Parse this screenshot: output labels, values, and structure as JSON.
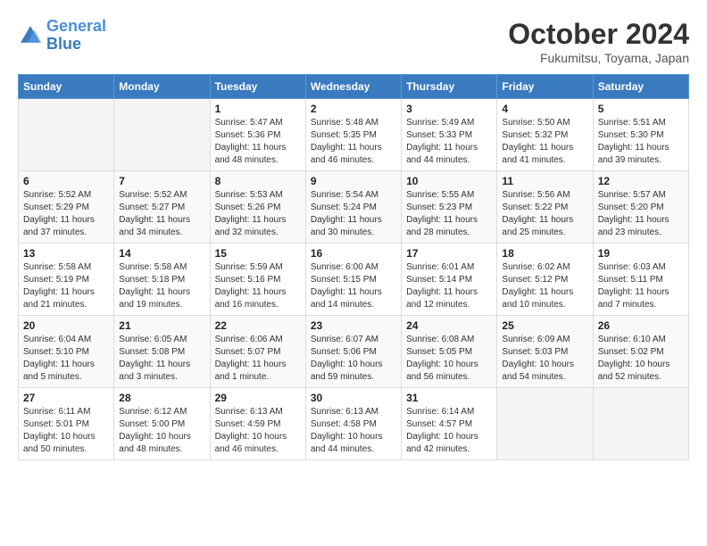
{
  "header": {
    "logo": {
      "line1": "General",
      "line2": "Blue"
    },
    "title": "October 2024",
    "location": "Fukumitsu, Toyama, Japan"
  },
  "columns": [
    "Sunday",
    "Monday",
    "Tuesday",
    "Wednesday",
    "Thursday",
    "Friday",
    "Saturday"
  ],
  "weeks": [
    [
      {
        "day": "",
        "info": ""
      },
      {
        "day": "",
        "info": ""
      },
      {
        "day": "1",
        "info": "Sunrise: 5:47 AM\nSunset: 5:36 PM\nDaylight: 11 hours and 48 minutes."
      },
      {
        "day": "2",
        "info": "Sunrise: 5:48 AM\nSunset: 5:35 PM\nDaylight: 11 hours and 46 minutes."
      },
      {
        "day": "3",
        "info": "Sunrise: 5:49 AM\nSunset: 5:33 PM\nDaylight: 11 hours and 44 minutes."
      },
      {
        "day": "4",
        "info": "Sunrise: 5:50 AM\nSunset: 5:32 PM\nDaylight: 11 hours and 41 minutes."
      },
      {
        "day": "5",
        "info": "Sunrise: 5:51 AM\nSunset: 5:30 PM\nDaylight: 11 hours and 39 minutes."
      }
    ],
    [
      {
        "day": "6",
        "info": "Sunrise: 5:52 AM\nSunset: 5:29 PM\nDaylight: 11 hours and 37 minutes."
      },
      {
        "day": "7",
        "info": "Sunrise: 5:52 AM\nSunset: 5:27 PM\nDaylight: 11 hours and 34 minutes."
      },
      {
        "day": "8",
        "info": "Sunrise: 5:53 AM\nSunset: 5:26 PM\nDaylight: 11 hours and 32 minutes."
      },
      {
        "day": "9",
        "info": "Sunrise: 5:54 AM\nSunset: 5:24 PM\nDaylight: 11 hours and 30 minutes."
      },
      {
        "day": "10",
        "info": "Sunrise: 5:55 AM\nSunset: 5:23 PM\nDaylight: 11 hours and 28 minutes."
      },
      {
        "day": "11",
        "info": "Sunrise: 5:56 AM\nSunset: 5:22 PM\nDaylight: 11 hours and 25 minutes."
      },
      {
        "day": "12",
        "info": "Sunrise: 5:57 AM\nSunset: 5:20 PM\nDaylight: 11 hours and 23 minutes."
      }
    ],
    [
      {
        "day": "13",
        "info": "Sunrise: 5:58 AM\nSunset: 5:19 PM\nDaylight: 11 hours and 21 minutes."
      },
      {
        "day": "14",
        "info": "Sunrise: 5:58 AM\nSunset: 5:18 PM\nDaylight: 11 hours and 19 minutes."
      },
      {
        "day": "15",
        "info": "Sunrise: 5:59 AM\nSunset: 5:16 PM\nDaylight: 11 hours and 16 minutes."
      },
      {
        "day": "16",
        "info": "Sunrise: 6:00 AM\nSunset: 5:15 PM\nDaylight: 11 hours and 14 minutes."
      },
      {
        "day": "17",
        "info": "Sunrise: 6:01 AM\nSunset: 5:14 PM\nDaylight: 11 hours and 12 minutes."
      },
      {
        "day": "18",
        "info": "Sunrise: 6:02 AM\nSunset: 5:12 PM\nDaylight: 11 hours and 10 minutes."
      },
      {
        "day": "19",
        "info": "Sunrise: 6:03 AM\nSunset: 5:11 PM\nDaylight: 11 hours and 7 minutes."
      }
    ],
    [
      {
        "day": "20",
        "info": "Sunrise: 6:04 AM\nSunset: 5:10 PM\nDaylight: 11 hours and 5 minutes."
      },
      {
        "day": "21",
        "info": "Sunrise: 6:05 AM\nSunset: 5:08 PM\nDaylight: 11 hours and 3 minutes."
      },
      {
        "day": "22",
        "info": "Sunrise: 6:06 AM\nSunset: 5:07 PM\nDaylight: 11 hours and 1 minute."
      },
      {
        "day": "23",
        "info": "Sunrise: 6:07 AM\nSunset: 5:06 PM\nDaylight: 10 hours and 59 minutes."
      },
      {
        "day": "24",
        "info": "Sunrise: 6:08 AM\nSunset: 5:05 PM\nDaylight: 10 hours and 56 minutes."
      },
      {
        "day": "25",
        "info": "Sunrise: 6:09 AM\nSunset: 5:03 PM\nDaylight: 10 hours and 54 minutes."
      },
      {
        "day": "26",
        "info": "Sunrise: 6:10 AM\nSunset: 5:02 PM\nDaylight: 10 hours and 52 minutes."
      }
    ],
    [
      {
        "day": "27",
        "info": "Sunrise: 6:11 AM\nSunset: 5:01 PM\nDaylight: 10 hours and 50 minutes."
      },
      {
        "day": "28",
        "info": "Sunrise: 6:12 AM\nSunset: 5:00 PM\nDaylight: 10 hours and 48 minutes."
      },
      {
        "day": "29",
        "info": "Sunrise: 6:13 AM\nSunset: 4:59 PM\nDaylight: 10 hours and 46 minutes."
      },
      {
        "day": "30",
        "info": "Sunrise: 6:13 AM\nSunset: 4:58 PM\nDaylight: 10 hours and 44 minutes."
      },
      {
        "day": "31",
        "info": "Sunrise: 6:14 AM\nSunset: 4:57 PM\nDaylight: 10 hours and 42 minutes."
      },
      {
        "day": "",
        "info": ""
      },
      {
        "day": "",
        "info": ""
      }
    ]
  ]
}
